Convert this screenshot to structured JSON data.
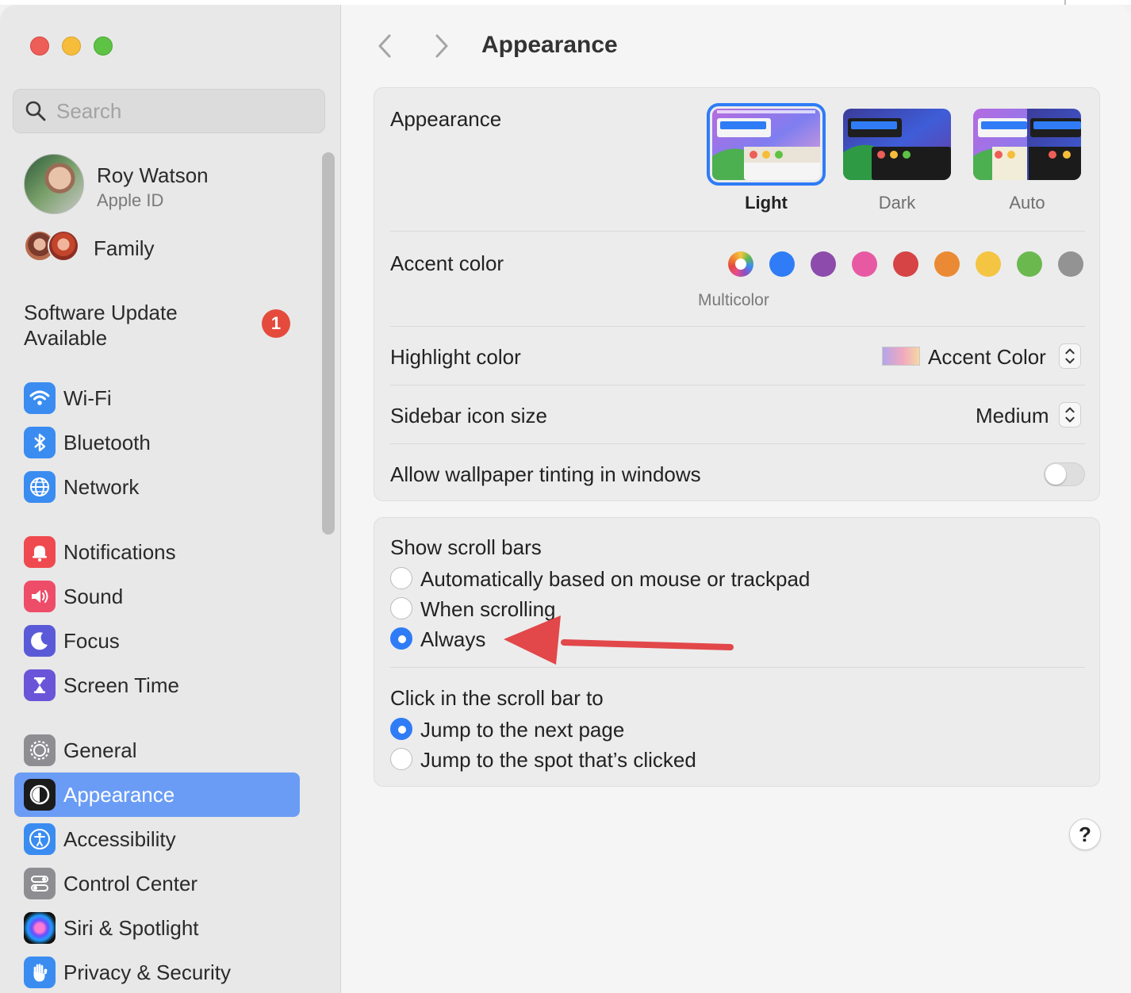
{
  "sidebar": {
    "search_placeholder": "Search",
    "account": {
      "name": "Roy Watson",
      "subtitle": "Apple ID"
    },
    "family_label": "Family",
    "update": {
      "label": "Software Update Available",
      "badge": "1"
    },
    "items": [
      {
        "label": "Wi-Fi",
        "icon": "wifi-icon",
        "color": "#3a8cf1"
      },
      {
        "label": "Bluetooth",
        "icon": "bluetooth-icon",
        "color": "#3a8cf1"
      },
      {
        "label": "Network",
        "icon": "globe-icon",
        "color": "#3a8cf1"
      },
      {
        "label": "Notifications",
        "icon": "bell-icon",
        "color": "#ef4a4f"
      },
      {
        "label": "Sound",
        "icon": "speaker-icon",
        "color": "#ee4d6a"
      },
      {
        "label": "Focus",
        "icon": "moon-icon",
        "color": "#5a5ad8"
      },
      {
        "label": "Screen Time",
        "icon": "hourglass-icon",
        "color": "#6a55d9"
      },
      {
        "label": "General",
        "icon": "gear-icon",
        "color": "#8d8d92"
      },
      {
        "label": "Appearance",
        "icon": "appearance-icon",
        "color": "#1b1b1b",
        "selected": true
      },
      {
        "label": "Accessibility",
        "icon": "accessibility-icon",
        "color": "#3a8cf1"
      },
      {
        "label": "Control Center",
        "icon": "toggles-icon",
        "color": "#8d8d92"
      },
      {
        "label": "Siri & Spotlight",
        "icon": "siri-icon",
        "color": "#6a4dff"
      },
      {
        "label": "Privacy & Security",
        "icon": "hand-icon",
        "color": "#3a8cf1"
      }
    ]
  },
  "main": {
    "title": "Appearance",
    "appearance": {
      "label": "Appearance",
      "options": [
        {
          "label": "Light",
          "selected": true
        },
        {
          "label": "Dark",
          "selected": false
        },
        {
          "label": "Auto",
          "selected": false
        }
      ]
    },
    "accent": {
      "label": "Accent color",
      "selected_caption": "Multicolor",
      "colors": [
        "multicolor",
        "#2f7cf6",
        "#8d4bab",
        "#e75aa3",
        "#d64446",
        "#ea8a34",
        "#f4c542",
        "#6bb84f",
        "#939393"
      ]
    },
    "highlight": {
      "label": "Highlight color",
      "value": "Accent Color"
    },
    "sidebar_icon_size": {
      "label": "Sidebar icon size",
      "value": "Medium"
    },
    "wallpaper_tinting": {
      "label": "Allow wallpaper tinting in windows",
      "enabled": false
    },
    "scroll_bars": {
      "label": "Show scroll bars",
      "options": [
        {
          "label": "Automatically based on mouse or trackpad",
          "selected": false
        },
        {
          "label": "When scrolling",
          "selected": false
        },
        {
          "label": "Always",
          "selected": true
        }
      ]
    },
    "click_scroll": {
      "label": "Click in the scroll bar to",
      "options": [
        {
          "label": "Jump to the next page",
          "selected": true
        },
        {
          "label": "Jump to the spot that’s clicked",
          "selected": false
        }
      ]
    },
    "help_label": "?"
  }
}
